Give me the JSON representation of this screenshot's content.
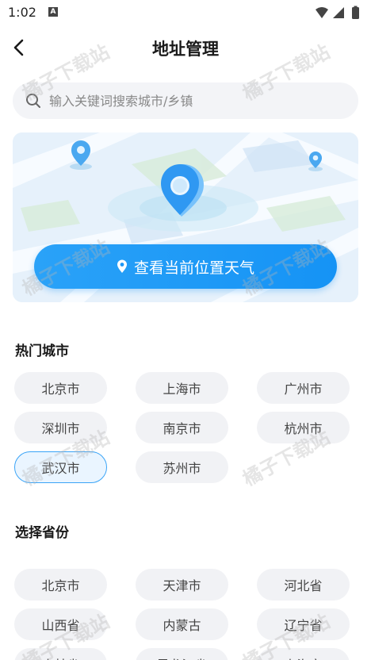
{
  "status_bar": {
    "time": "1:02",
    "badge": "A"
  },
  "header": {
    "title": "地址管理"
  },
  "search": {
    "placeholder": "输入关键词搜索城市/乡镇"
  },
  "locate": {
    "label": "查看当前位置天气"
  },
  "hot_cities": {
    "title": "热门城市",
    "items": [
      "北京市",
      "上海市",
      "广州市",
      "深圳市",
      "南京市",
      "杭州市",
      "武汉市",
      "苏州市"
    ],
    "selected_index": 6
  },
  "provinces": {
    "title": "选择省份",
    "items": [
      "北京市",
      "天津市",
      "河北省",
      "山西省",
      "内蒙古",
      "辽宁省",
      "吉林省",
      "黑龙江省",
      "上海市"
    ]
  },
  "watermark": "橘子下载站",
  "colors": {
    "accent": "#1593f5",
    "chip_bg": "#f1f2f5"
  }
}
